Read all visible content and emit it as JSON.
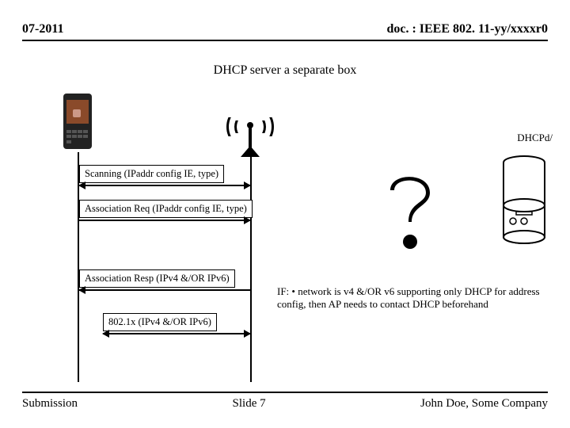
{
  "header": {
    "left": "07-2011",
    "right": "doc. : IEEE 802. 11-yy/xxxxr0"
  },
  "title": "DHCP server a separate box",
  "server_label": "DHCPd/",
  "messages": {
    "scanning": "Scanning (IPaddr config IE, type)",
    "assoc_req": "Association Req (IPaddr config IE, type)",
    "assoc_resp": "Association Resp (IPv4 &/OR IPv6)",
    "dot1x": "802.1x (IPv4 &/OR IPv6)"
  },
  "note": "IF: • network is v4 &/OR v6 supporting only DHCP for address config, then AP needs to contact DHCP beforehand",
  "footer": {
    "left": "Submission",
    "center": "Slide 7",
    "right": "John Doe, Some Company"
  },
  "icons": {
    "phone": "phone-icon",
    "wifi": "wifi-ap-icon",
    "qmark": "question-mark-icon",
    "server": "server-icon"
  }
}
